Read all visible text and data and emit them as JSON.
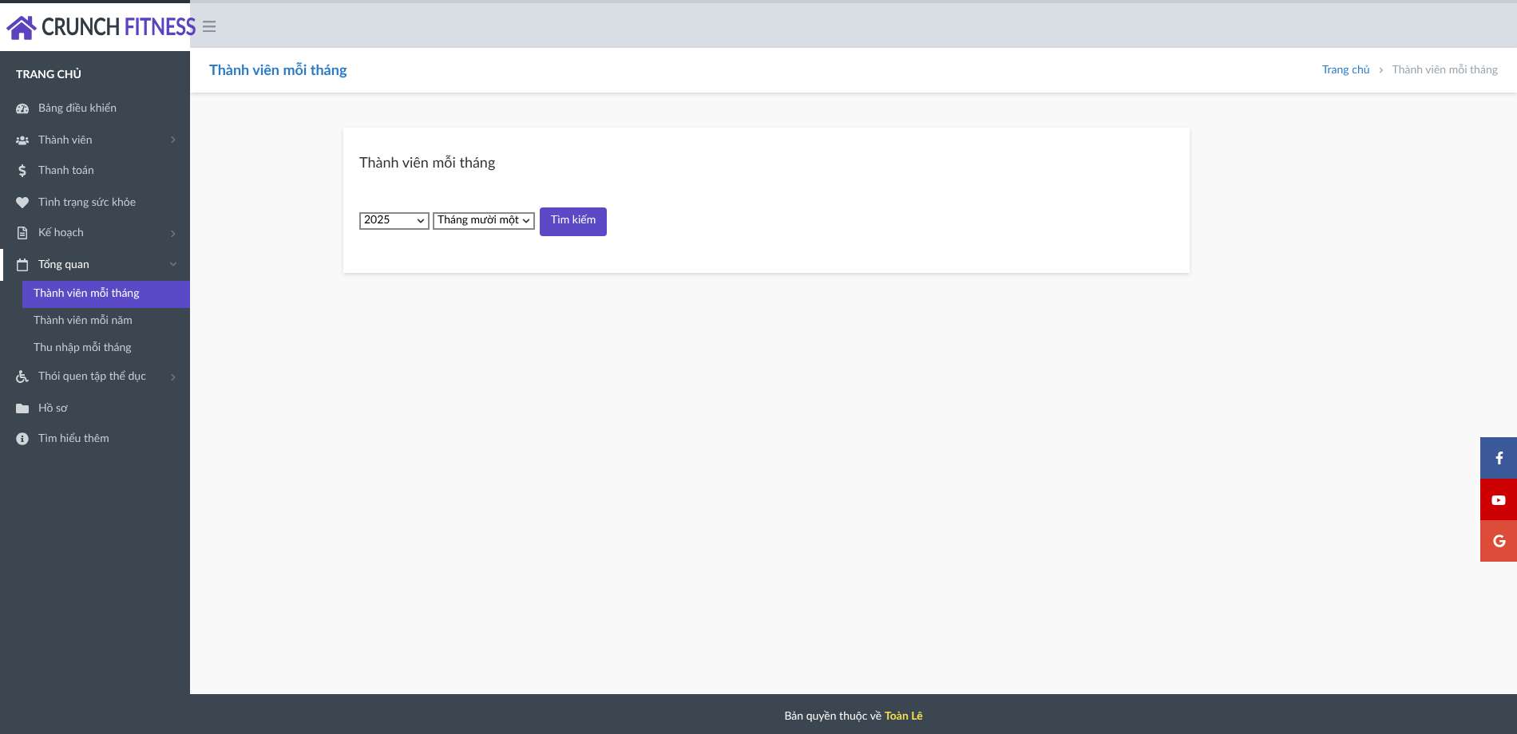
{
  "logo": {
    "word_1": "CRUNCH",
    "word_2": "FITNESS"
  },
  "sidebar": {
    "heading": "TRANG CHỦ",
    "items": [
      {
        "label": "Bảng điều khiển",
        "has_submenu": false,
        "expanded": false,
        "selected": false
      },
      {
        "label": "Thành viên",
        "has_submenu": true,
        "expanded": false,
        "selected": false
      },
      {
        "label": "Thanh toán",
        "has_submenu": false,
        "expanded": false,
        "selected": false
      },
      {
        "label": "Tình trạng sức khỏe",
        "has_submenu": false,
        "expanded": false,
        "selected": false
      },
      {
        "label": "Kế hoạch",
        "has_submenu": true,
        "expanded": false,
        "selected": false
      },
      {
        "label": "Tổng quan",
        "has_submenu": true,
        "expanded": true,
        "selected": true,
        "children": [
          {
            "label": "Thành viên mỗi tháng",
            "selected": true
          },
          {
            "label": "Thành viên mỗi năm",
            "selected": false
          },
          {
            "label": "Thu nhập mỗi tháng",
            "selected": false
          }
        ]
      },
      {
        "label": "Thói quen tập thể dục",
        "has_submenu": true,
        "expanded": false,
        "selected": false
      },
      {
        "label": "Hồ sơ",
        "has_submenu": false,
        "expanded": false,
        "selected": false
      },
      {
        "label": "Tìm hiểu thêm",
        "has_submenu": false,
        "expanded": false,
        "selected": false
      }
    ]
  },
  "page_title": "Thành viên mỗi tháng",
  "breadcrumb": [
    {
      "label": "Trang chủ",
      "link": true
    },
    {
      "label": "Thành viên mỗi tháng",
      "link": false
    }
  ],
  "card": {
    "title": "Thành viên mỗi tháng",
    "year": "2025",
    "month": "Tháng mười một",
    "button": "Tìm kiếm"
  },
  "footer": {
    "text": "Bản quyền thuộc về",
    "author": "Toàn Lê"
  }
}
